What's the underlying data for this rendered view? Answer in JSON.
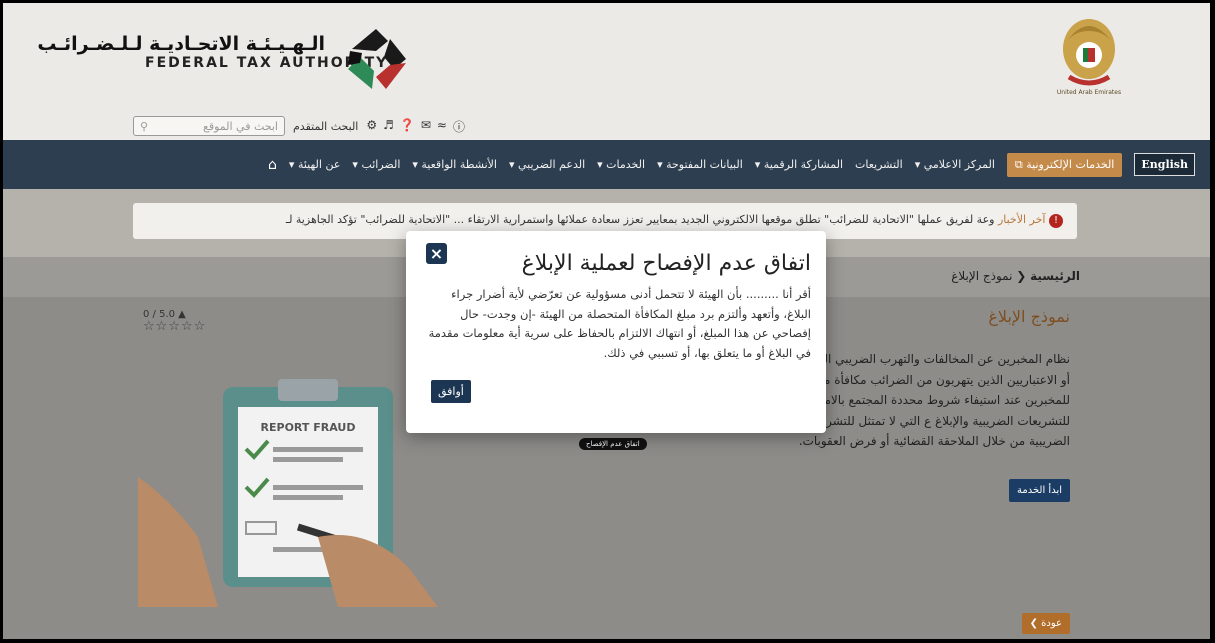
{
  "header": {
    "org_name_ar": "الـهـيـئـة الاتحـاديـة لـلـضـرائـب",
    "org_name_en": "FEDERAL TAX AUTHORITY",
    "emblem_caption": "United Arab Emirates",
    "search_placeholder": "ابحث في الموقع",
    "advanced_search": "البحث المتقدم"
  },
  "nav": {
    "items": [
      "عن الهيئة",
      "الضرائب",
      "الأنشطة الواقعية",
      "الدعم الضريبي",
      "الخدمات",
      "البيانات المفتوحة",
      "المشاركة الرقمية",
      "التشريعات",
      "المركز الاعلامي"
    ],
    "eservices": "الخدمات الإلكترونية",
    "english": "English"
  },
  "ticker": {
    "label": "آخر الأخبار",
    "text": "وعة لفريق عملها  \"الاتحادية للضرائب\" تطلق موقعها الالكتروني الجديد بمعايير تعزز سعادة عملائها واستمرارية الارتقاء ...   \"الاتحادية للضرائب\" تؤكد الجاهزية لـ"
  },
  "breadcrumb": {
    "home": "الرئيسية",
    "current": "نموذج الإبلاغ"
  },
  "page": {
    "title": "نموذج الإبلاغ",
    "rating": "0 / 5.0",
    "body": "نظام المخبرين عن المخالفات والتهرب الضريبي الطبيعيين أو الاعتباريين الذين يتهربون من الضرائب مكافأة مالية للمخبرين عند استيفاء شروط محددة المجتمع بالامتثال للتشريعات الضريبية والإبلاغ ع التي لا تمتثل للتشريعات الضريبية من خلال الملاحقة القضائية أو فرض العقوبات.",
    "nda_pill": "اتفاق عدم الإفصاح",
    "start_button": "ابدأ الخدمة",
    "back_button": "عودة",
    "illustration_title": "REPORT FRAUD"
  },
  "modal": {
    "title": "اتفاق عدم الإفصاح لعملية الإبلاغ",
    "body": "أقر أنا ......... بأن الهيئة لا تتحمل أدنى مسؤولية عن تعرّضي لأية أضرار جراء البلاغ، وأتعهد وألتزم برد مبلغ المكافأة المتحصلة من الهيئة -إن وجدت- حال إفصاحي عن هذا المبلغ، أو انتهاك الالتزام بالحفاظ على سرية أية معلومات مقدمة في البلاغ أو ما يتعلق بها، أو تسببي في ذلك.",
    "agree": "أوافق",
    "close": "×"
  },
  "colors": {
    "nav": "#2d3e50",
    "accent": "#c48a4a",
    "primary_button": "#1b3553"
  }
}
